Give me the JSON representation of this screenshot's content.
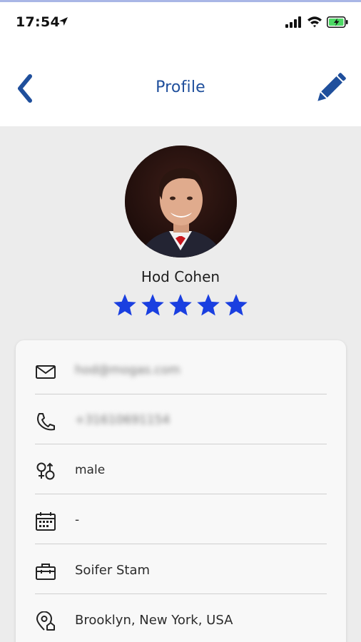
{
  "status_bar": {
    "time": "17:54",
    "icons": [
      "location-arrow-icon",
      "cellular-signal-icon",
      "wifi-icon",
      "battery-charging-icon"
    ]
  },
  "nav": {
    "title": "Profile",
    "back_icon": "chevron-left-icon",
    "edit_icon": "pencil-icon",
    "accent": "#1f4f9c"
  },
  "profile": {
    "name": "Hod Cohen",
    "rating": 5,
    "rating_max": 5,
    "star_color": "#1a3fe0"
  },
  "details": [
    {
      "icon": "mail-icon",
      "value": "hod@mogas.com",
      "obscured": true
    },
    {
      "icon": "phone-icon",
      "value": "+31610691154",
      "obscured": true
    },
    {
      "icon": "gender-icon",
      "value": "male",
      "obscured": false
    },
    {
      "icon": "calendar-icon",
      "value": "-",
      "obscured": false
    },
    {
      "icon": "briefcase-icon",
      "value": "Soifer Stam",
      "obscured": false
    },
    {
      "icon": "location-pin-icon",
      "value": "Brooklyn, New York, USA",
      "obscured": false
    }
  ]
}
